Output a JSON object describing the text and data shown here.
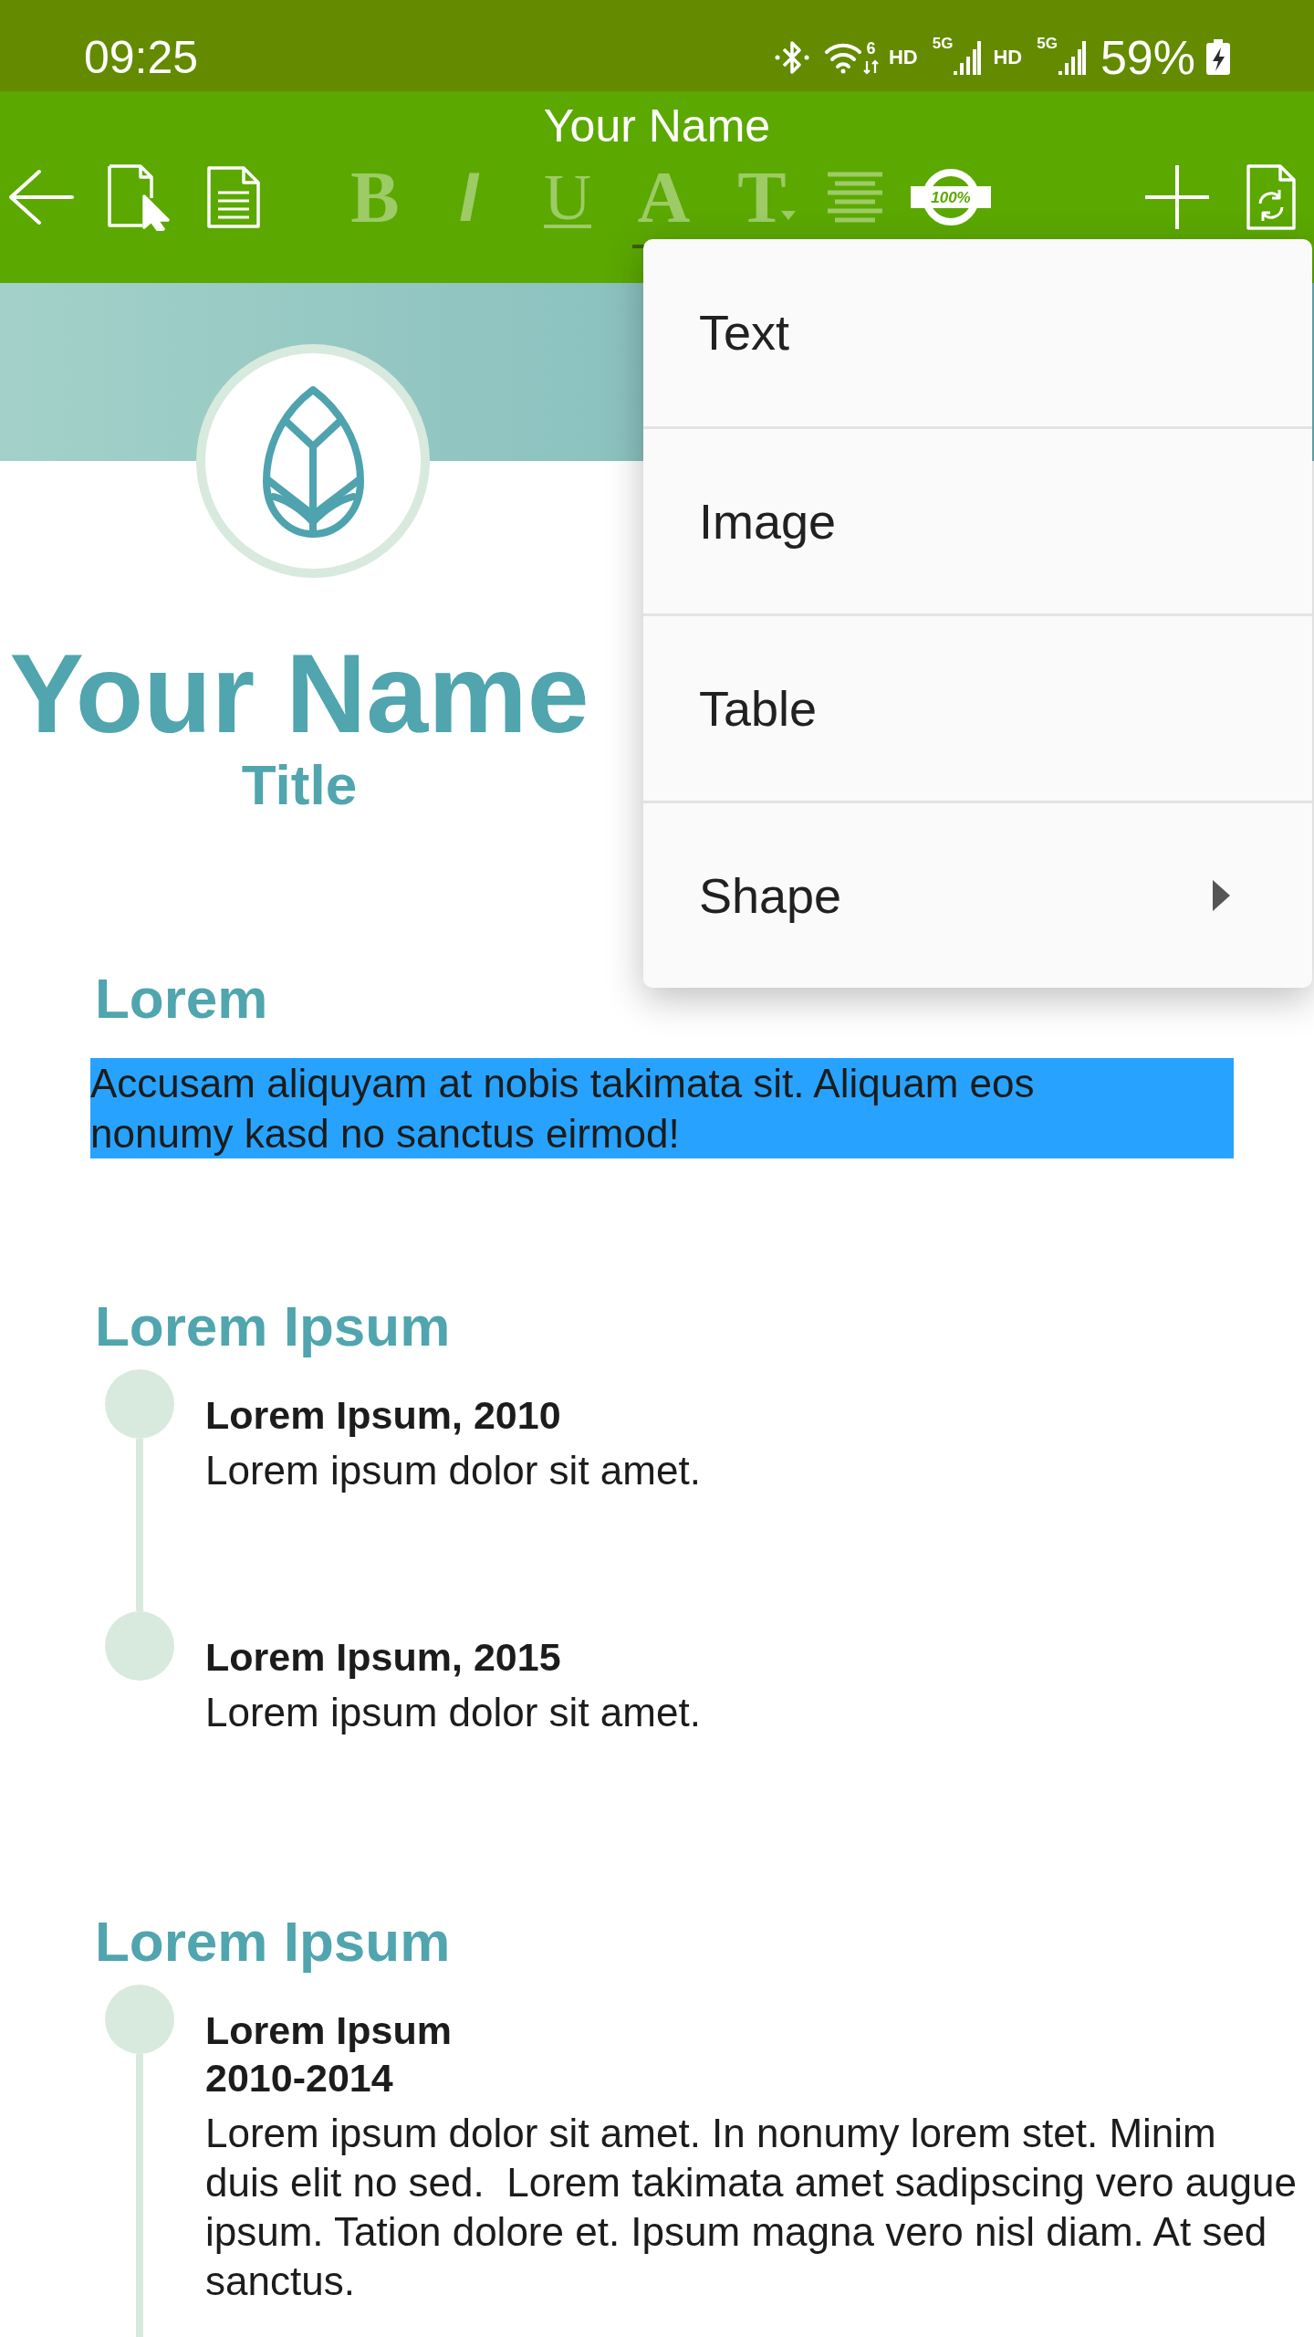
{
  "status_bar": {
    "time": "09:25",
    "wifi_badge": "6",
    "sims": [
      {
        "label": "HD",
        "network": "5G"
      },
      {
        "label": "HD",
        "network": "5G"
      }
    ],
    "battery": "59%",
    "battery_charging": true
  },
  "app_bar": {
    "title": "Your Name",
    "toolbar": [
      {
        "kind": "back",
        "disabled": false
      },
      {
        "kind": "select_document",
        "disabled": false
      },
      {
        "kind": "page",
        "disabled": false
      },
      {
        "kind": "bold",
        "label": "B",
        "disabled": true
      },
      {
        "kind": "italic",
        "label": "I",
        "disabled": true
      },
      {
        "kind": "underline",
        "label": "U",
        "disabled": true
      },
      {
        "kind": "text_color",
        "label": "A",
        "disabled": true
      },
      {
        "kind": "text_size",
        "label": "T",
        "disabled": true
      },
      {
        "kind": "align",
        "disabled": true
      },
      {
        "kind": "zoom",
        "label": "100%",
        "disabled": false
      },
      {
        "kind": "insert",
        "disabled": false
      },
      {
        "kind": "convert",
        "disabled": false
      }
    ]
  },
  "document": {
    "name": "Your Name",
    "title": "Title",
    "sections": [
      {
        "kind": "paragraph",
        "heading": "Lorem",
        "text": "Accusam aliquyam at nobis takimata sit. Aliquam eos nonumy kasd no sanctus eirmod!",
        "selected": true
      },
      {
        "kind": "timeline",
        "heading": "Lorem Ipsum",
        "entries": [
          {
            "title": "Lorem Ipsum, 2010",
            "text": "Lorem ipsum dolor sit amet.",
            "line_below": true
          },
          {
            "title": "Lorem Ipsum, 2015",
            "text": "Lorem ipsum dolor sit amet.",
            "line_below": false
          }
        ]
      },
      {
        "kind": "timeline",
        "heading": "Lorem Ipsum",
        "entries": [
          {
            "title": "Lorem Ipsum",
            "subtitle": "2010-2014",
            "text": "Lorem ipsum dolor sit amet. In nonumy lorem stet. Minim duis elit no sed.  Lorem takimata amet sadipscing vero augue ipsum. Tation dolore et. Ipsum magna vero nisl diam. At sed sanctus.",
            "line_below": true
          }
        ]
      }
    ]
  },
  "insert_menu": {
    "items": [
      {
        "label": "Text",
        "has_submenu": false
      },
      {
        "label": "Image",
        "has_submenu": false
      },
      {
        "label": "Table",
        "has_submenu": false
      },
      {
        "label": "Shape",
        "has_submenu": true
      }
    ]
  }
}
